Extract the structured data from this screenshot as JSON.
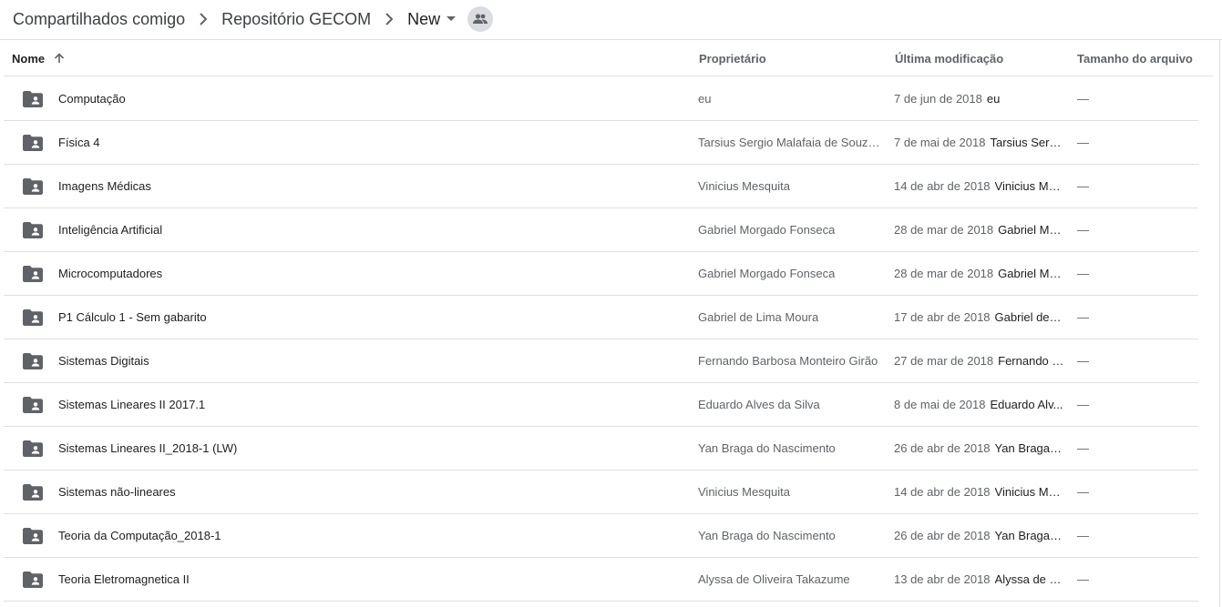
{
  "breadcrumb": {
    "items": [
      "Compartilhados comigo",
      "Repositório GECOM",
      "New"
    ]
  },
  "columns": {
    "name": "Nome",
    "owner": "Proprietário",
    "modified": "Última modificação",
    "size": "Tamanho do arquivo"
  },
  "rows": [
    {
      "name": "Computação",
      "owner": "eu",
      "date": "7 de jun de 2018",
      "by": "eu",
      "size": "—"
    },
    {
      "name": "Física 4",
      "owner": "Tarsius Sergio Malafaia de Souza...",
      "date": "7 de mai de 2018",
      "by": "Tarsius Sergi...",
      "size": "—"
    },
    {
      "name": "Imagens Médicas",
      "owner": "Vinicius Mesquita",
      "date": "14 de abr de 2018",
      "by": "Vinicius Me...",
      "size": "—"
    },
    {
      "name": "Inteligência Artificial",
      "owner": "Gabriel Morgado Fonseca",
      "date": "28 de mar de 2018",
      "by": "Gabriel Mo...",
      "size": "—"
    },
    {
      "name": "Microcomputadores",
      "owner": "Gabriel Morgado Fonseca",
      "date": "28 de mar de 2018",
      "by": "Gabriel Mo...",
      "size": "—"
    },
    {
      "name": "P1 Cálculo 1 - Sem gabarito",
      "owner": "Gabriel de Lima Moura",
      "date": "17 de abr de 2018",
      "by": "Gabriel de L...",
      "size": "—"
    },
    {
      "name": "Sistemas Digitais",
      "owner": "Fernando Barbosa Monteiro Girão",
      "date": "27 de mar de 2018",
      "by": "Fernando B...",
      "size": "—"
    },
    {
      "name": "Sistemas Lineares II 2017.1",
      "owner": "Eduardo Alves da Silva",
      "date": "8 de mai de 2018",
      "by": "Eduardo Alv...",
      "size": "—"
    },
    {
      "name": "Sistemas Lineares II_2018-1 (LW)",
      "owner": "Yan Braga do Nascimento",
      "date": "26 de abr de 2018",
      "by": "Yan Braga d...",
      "size": "—"
    },
    {
      "name": "Sistemas não-lineares",
      "owner": "Vinicius Mesquita",
      "date": "14 de abr de 2018",
      "by": "Vinicius Me...",
      "size": "—"
    },
    {
      "name": "Teoria da Computação_2018-1",
      "owner": "Yan Braga do Nascimento",
      "date": "26 de abr de 2018",
      "by": "Yan Braga d...",
      "size": "—"
    },
    {
      "name": "Teoria Eletromagnetica II",
      "owner": "Alyssa de Oliveira Takazume",
      "date": "13 de abr de 2018",
      "by": "Alyssa de O...",
      "size": "—"
    }
  ],
  "icons": {
    "folder": "shared-folder-icon",
    "chevron": "chevron-right-icon",
    "caret": "dropdown-caret-icon",
    "people": "people-icon",
    "sort": "arrow-up-icon"
  },
  "colors": {
    "icon": "#5f6368",
    "divider": "#e0e0e0",
    "badge": "#dadce0"
  }
}
